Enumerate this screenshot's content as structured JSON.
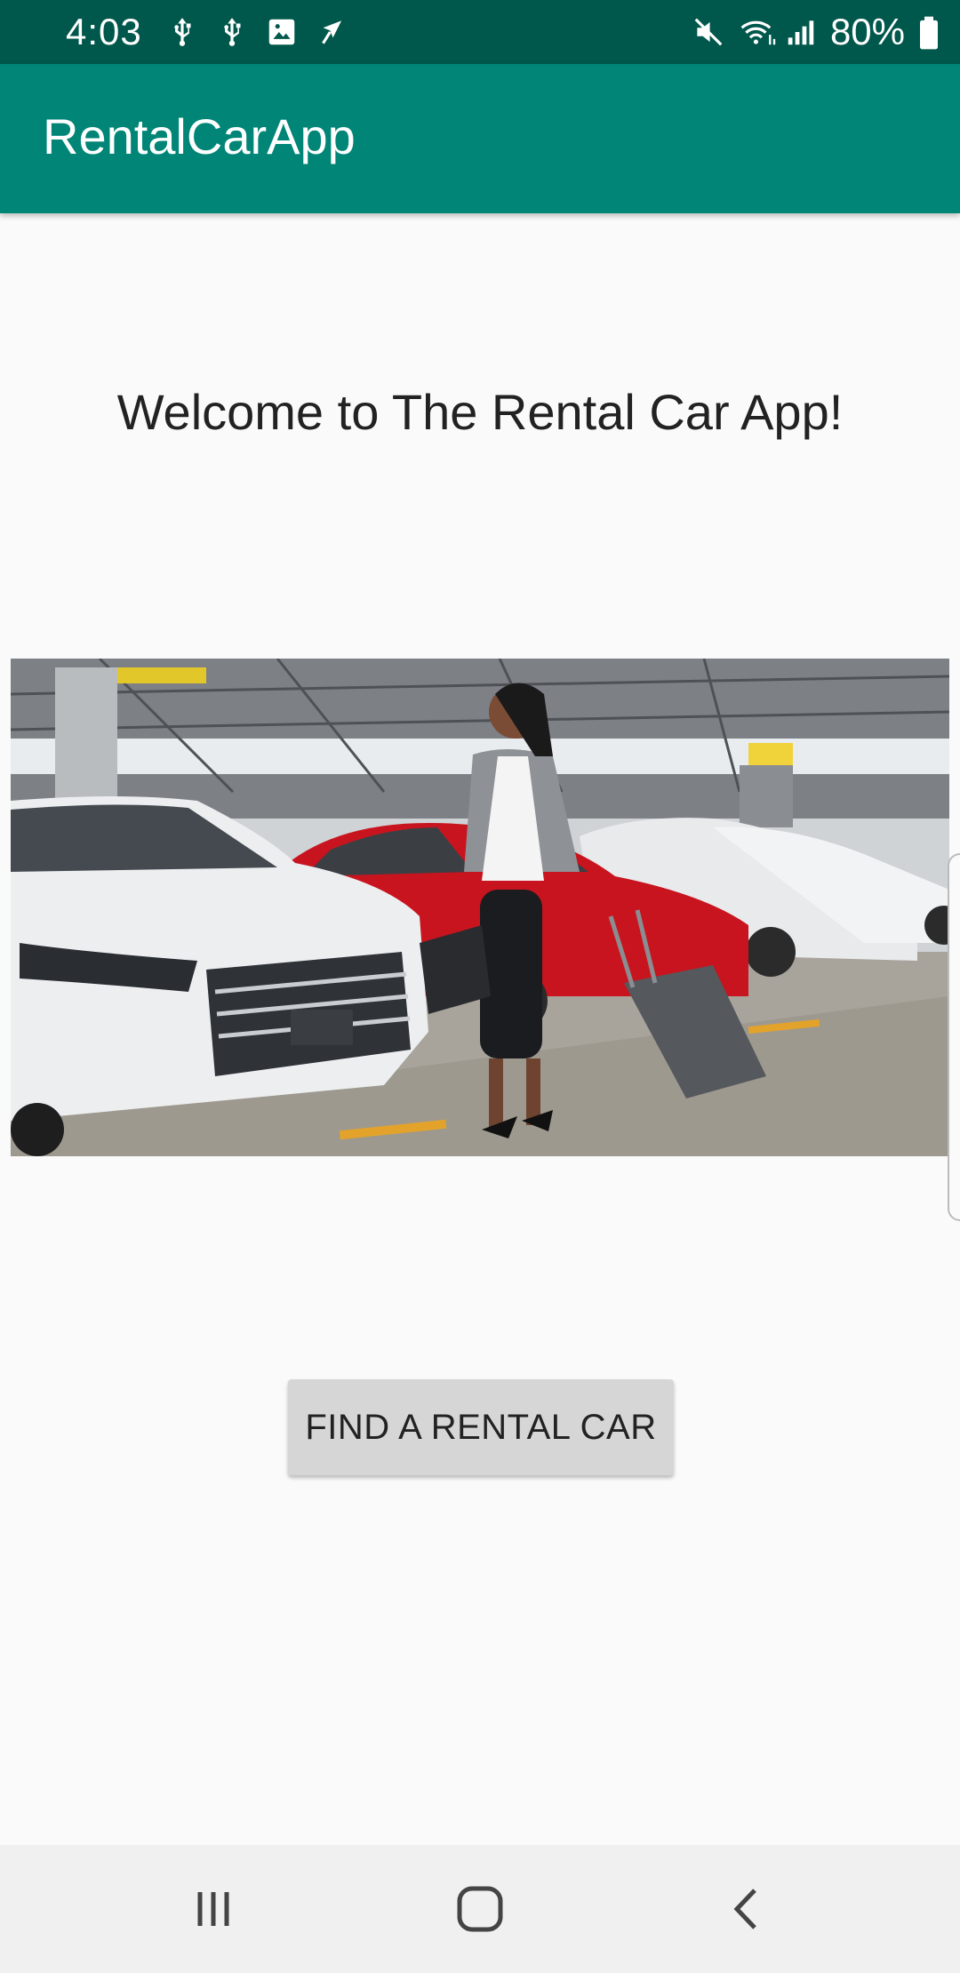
{
  "status_bar": {
    "time": "4:03",
    "battery_percent": "80%",
    "left_icons": [
      "usb-icon",
      "usb-icon",
      "image-icon",
      "navigation-icon"
    ],
    "right_icons": [
      "mute-icon",
      "wifi-icon",
      "signal-icon",
      "battery-icon"
    ]
  },
  "app_bar": {
    "title": "RentalCarApp"
  },
  "main": {
    "welcome_text": "Welcome to The Rental Car App!",
    "hero_image": "car-rental-garage-photo",
    "find_button_label": "FIND A RENTAL CAR"
  },
  "nav_bar": {
    "buttons": [
      "recent-apps-icon",
      "home-icon",
      "back-icon"
    ]
  },
  "colors": {
    "status_bar": "#00574b",
    "app_bar": "#008577",
    "button_bg": "#d6d6d6",
    "background": "#fafafa"
  }
}
